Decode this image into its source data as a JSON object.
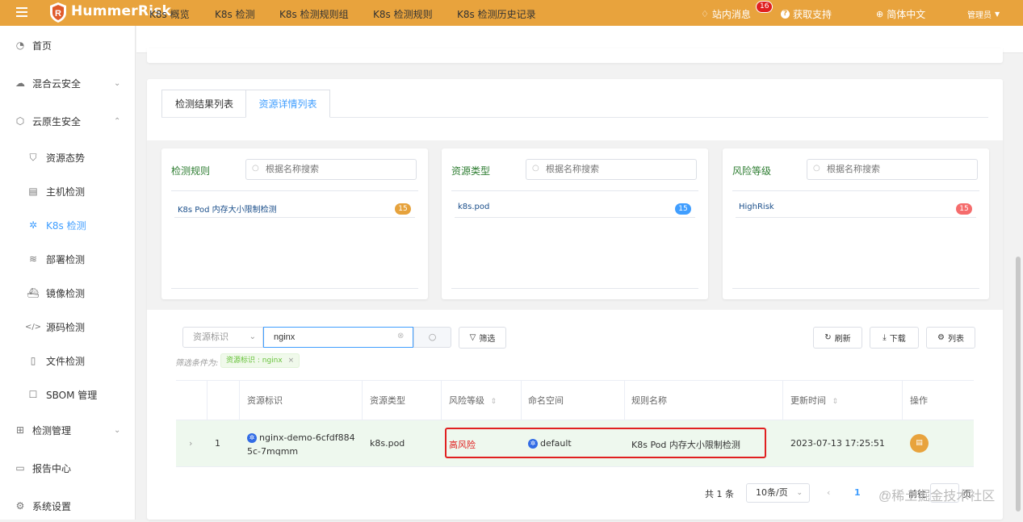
{
  "topbar": {
    "brand": "HummerRisk",
    "messages_label": "站内消息",
    "messages_count": "16",
    "support_label": "获取支持",
    "language_label": "简体中文",
    "user_label": "管理员",
    "brand_color": "#e8a33d"
  },
  "sidebar": {
    "items": [
      {
        "label": "首页",
        "icon": "dashboard-icon"
      },
      {
        "label": "混合云安全",
        "icon": "cloud-icon"
      },
      {
        "label": "云原生安全",
        "icon": "cloud-native-icon"
      },
      {
        "label": "资源态势",
        "icon": "shield-icon"
      },
      {
        "label": "主机检测",
        "icon": "server-icon"
      },
      {
        "label": "K8s 检测",
        "icon": "kubernetes-icon"
      },
      {
        "label": "部署检测",
        "icon": "layers-icon"
      },
      {
        "label": "镜像检测",
        "icon": "docker-icon"
      },
      {
        "label": "源码检测",
        "icon": "code-icon"
      },
      {
        "label": "文件检测",
        "icon": "file-icon"
      },
      {
        "label": "SBOM 管理",
        "icon": "sbom-icon"
      },
      {
        "label": "检测管理",
        "icon": "grid-icon"
      },
      {
        "label": "报告中心",
        "icon": "monitor-icon"
      },
      {
        "label": "系统设置",
        "icon": "gear-icon"
      }
    ]
  },
  "k8s_tabs": [
    "K8s 概览",
    "K8s 检测",
    "K8s 检测规则组",
    "K8s 检测规则",
    "K8s 检测历史记录"
  ],
  "result_tabs": [
    "检测结果列表",
    "资源详情列表"
  ],
  "panels": [
    {
      "title": "检测规则",
      "placeholder": "根据名称搜索",
      "item": "K8s Pod 内存大小限制检测",
      "count": "15",
      "count_color": "#e6a23c"
    },
    {
      "title": "资源类型",
      "placeholder": "根据名称搜索",
      "item": "k8s.pod",
      "count": "15",
      "count_color": "#409eff"
    },
    {
      "title": "风险等级",
      "placeholder": "根据名称搜索",
      "item": "HighRisk",
      "count": "15",
      "count_color": "#f56c6c"
    }
  ],
  "filter": {
    "field": "资源标识",
    "value": "nginx",
    "filter_button": "筛选",
    "refresh_button": "刷新",
    "download_button": "下载",
    "columns_button": "列表",
    "condition_label": "筛选条件为:",
    "condition_tag": "资源标识 : nginx"
  },
  "table": {
    "headers": [
      "资源标识",
      "资源类型",
      "风险等级",
      "命名空间",
      "规则名称",
      "更新时间",
      "操作"
    ],
    "row": {
      "index": "1",
      "resource_id_line1": "nginx-demo-6cfdf884",
      "resource_id_line2": "5c-7mqmm",
      "resource_type": "k8s.pod",
      "risk_level": "高风险",
      "namespace": "default",
      "rule_name": "K8s Pod 内存大小限制检测",
      "update_time": "2023-07-13 17:25:51"
    }
  },
  "pagination": {
    "total": "共 1 条",
    "page_size": "10条/页",
    "current_page": "1",
    "goto_label": "前往",
    "page_unit": "页"
  },
  "watermark": "@稀土掘金技术社区"
}
